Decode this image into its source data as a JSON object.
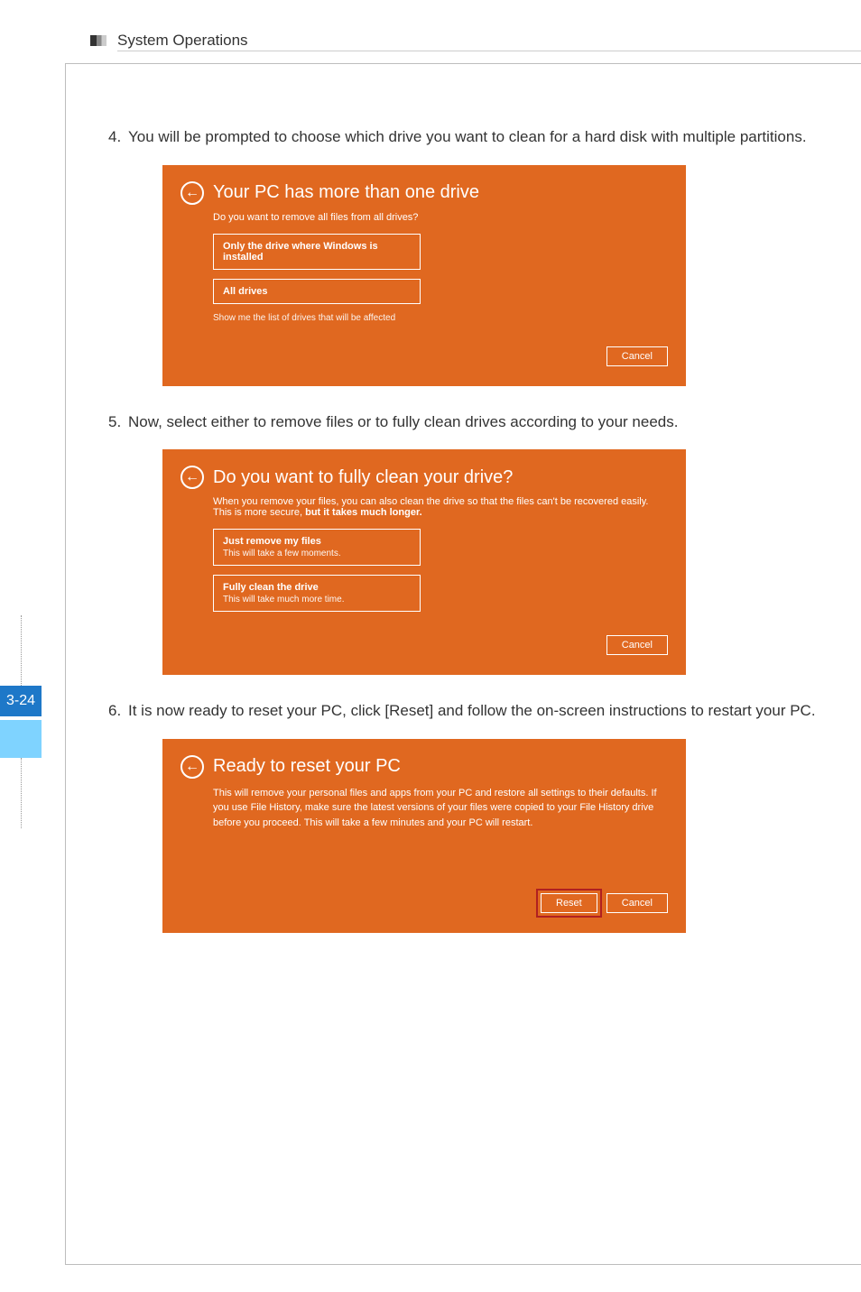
{
  "header": {
    "title": "System Operations"
  },
  "page_number": "3-24",
  "steps": {
    "s4": {
      "num": "4.",
      "text": "You will be prompted to choose which drive you want to clean for a hard disk with multiple partitions."
    },
    "s5": {
      "num": "5.",
      "text": "Now, select either to remove files or to fully clean drives according to your needs."
    },
    "s6": {
      "num": "6.",
      "text": "It is now ready to reset your PC, click [Reset] and follow the on-screen instructions to restart your PC."
    }
  },
  "panel1": {
    "title": "Your PC has more than one drive",
    "subtitle": "Do you want to remove all files from all drives?",
    "opt1": "Only the drive where Windows is installed",
    "opt2": "All drives",
    "link": "Show me the list of drives that will be affected",
    "cancel": "Cancel"
  },
  "panel2": {
    "title": "Do you want to fully clean your drive?",
    "sub_a": "When you remove your files, you can also clean the drive so that the files can't be recovered easily.",
    "sub_b": "This is more secure, ",
    "sub_c": "but it takes much longer.",
    "opt1_title": "Just remove my files",
    "opt1_desc": "This will take a few moments.",
    "opt2_title": "Fully clean the drive",
    "opt2_desc": "This will take much more time.",
    "cancel": "Cancel"
  },
  "panel3": {
    "title": "Ready to reset your PC",
    "body": "This will remove your personal files and apps from your PC and restore all settings to their defaults. If you use File History, make sure the latest versions of your files were copied to your File History drive before you proceed. This will take a few minutes and your PC will restart.",
    "reset": "Reset",
    "cancel": "Cancel"
  }
}
